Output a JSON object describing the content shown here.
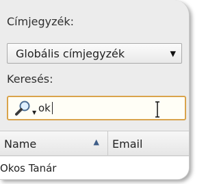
{
  "address_book": {
    "label": "Címjegyzék:",
    "selected": "Globális címjegyzék"
  },
  "search": {
    "label": "Keresés:",
    "value": "ok"
  },
  "table": {
    "columns": [
      "Name",
      "Email"
    ],
    "rows": [
      {
        "name": "Okos Tanár",
        "email": ""
      }
    ]
  }
}
